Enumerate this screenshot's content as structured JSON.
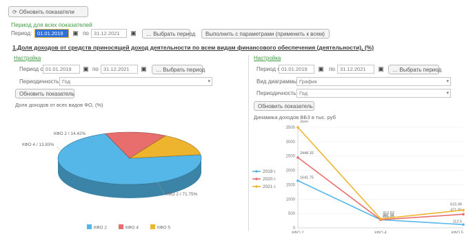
{
  "toolbar": {
    "refresh_all_label": "Обновить показатели"
  },
  "global_period": {
    "title": "Период для всех показателей",
    "period_label": "Период:",
    "date_from": "01.01.2019",
    "to_label": "по",
    "date_to": "31.12.2021",
    "choose_period_label": "Выбрать период",
    "apply_params_label": "Выполнить с параметрами (применить к всем)"
  },
  "section": {
    "title": "1.Доля доходов от средств приносящей доход деятельности по всем видам финансового обеспечения (деятельности), (%)"
  },
  "left_panel": {
    "settings_link": "Настройка",
    "period_from_label": "Период с",
    "date_from": "01.01.2019",
    "to_label": "по",
    "date_to": "31.12.2021",
    "choose_period_label": "Выбрать период",
    "periodicity_label": "Периодичность:",
    "periodicity_value": "Год",
    "refresh_label": "Обновить показатель",
    "chart_caption": "Доля доходов от всех видов ФО, (%)"
  },
  "right_panel": {
    "settings_link": "Настройка",
    "period_from_label": "Период с",
    "date_from": "01.01.2019",
    "to_label": "по",
    "date_to": "31.12.2021",
    "choose_period_label": "Выбрать период",
    "chart_type_label": "Вид диаграммы:",
    "chart_type_value": "График",
    "periodicity_label": "Периодичность:",
    "periodicity_value": "Год",
    "refresh_label": "Обновить показатель",
    "chart_caption": "Динамика доходов ВБЗ в тыс. руб"
  },
  "colors": {
    "accent_green": "#3f9a3f",
    "blue": "#54b7e8",
    "red": "#e86e6e",
    "yellow": "#efb42d"
  },
  "chart_data": [
    {
      "type": "pie",
      "categories": [
        "КФО 2",
        "КФО 4",
        "КФО 5"
      ],
      "values": [
        71.75,
        13.83,
        14.42
      ],
      "slice_labels": [
        "КФО 2 / 71.75%",
        "КФО 4 / 13.83%",
        "КФО 2 / 14.42%"
      ],
      "legend": [
        "КФО 2",
        "КФО 4",
        "КФО 5"
      ],
      "legend_position": "bottom",
      "colors": [
        "#54b7e8",
        "#e86e6e",
        "#efb42d"
      ]
    },
    {
      "type": "line",
      "categories": [
        "КФО 2",
        "КФО 4",
        "КФО 5"
      ],
      "series": [
        {
          "name": "2019 г.",
          "values": [
            1641.75,
            281.75,
            112.5
          ],
          "color": "#54b7e8"
        },
        {
          "name": "2020 г.",
          "values": [
            2448.32,
            281.21,
            471.91
          ],
          "color": "#e86e6e"
        },
        {
          "name": "2021 г.",
          "values": [
            3500,
            312.53,
            615.99
          ],
          "color": "#efb42d"
        }
      ],
      "ylim": [
        0,
        3500
      ],
      "yticks": [
        0,
        500,
        1000,
        1500,
        2000,
        2500,
        3000,
        3500
      ],
      "legend_position": "left",
      "grid": true
    }
  ]
}
